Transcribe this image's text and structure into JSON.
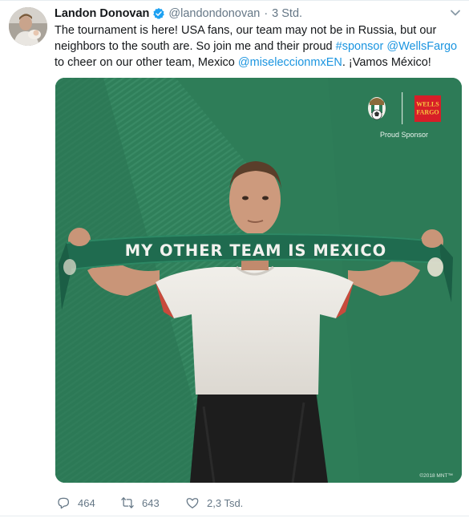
{
  "tweet": {
    "author_name": "Landon Donovan",
    "handle": "@landondonovan",
    "separator": "·",
    "time": "3 Std.",
    "text": {
      "p1": "The tournament is here! USA fans, our team may not be in Russia, but our neighbors to the south are. So join me and their proud ",
      "hashtag": "#sponsor",
      "space1": " ",
      "mention1": "@WellsFargo",
      "p2": " to cheer on our other team, Mexico ",
      "mention2": "@miseleccionmxEN",
      "p3": ". ¡Vamos México!"
    },
    "media": {
      "scarf_text": "MY OTHER TEAM IS MEXICO",
      "sponsor_logo_line1": "WELLS",
      "sponsor_logo_line2": "FARGO",
      "sponsor_caption": "Proud Sponsor",
      "copyright": "©2018 MNT™"
    },
    "actions": {
      "replies": "464",
      "retweets": "643",
      "likes": "2,3 Tsd."
    }
  },
  "icons": {
    "verified": "verified-badge-icon",
    "more": "chevron-down-icon",
    "reply": "reply-icon",
    "retweet": "retweet-icon",
    "like": "heart-icon"
  },
  "colors": {
    "link": "#1b95e0",
    "secondary_text": "#657786",
    "verified": "#1da1f2",
    "background_green": "#2e7d58",
    "scarf_green": "#1f6b4f",
    "wells_fargo_red": "#d71e28"
  }
}
